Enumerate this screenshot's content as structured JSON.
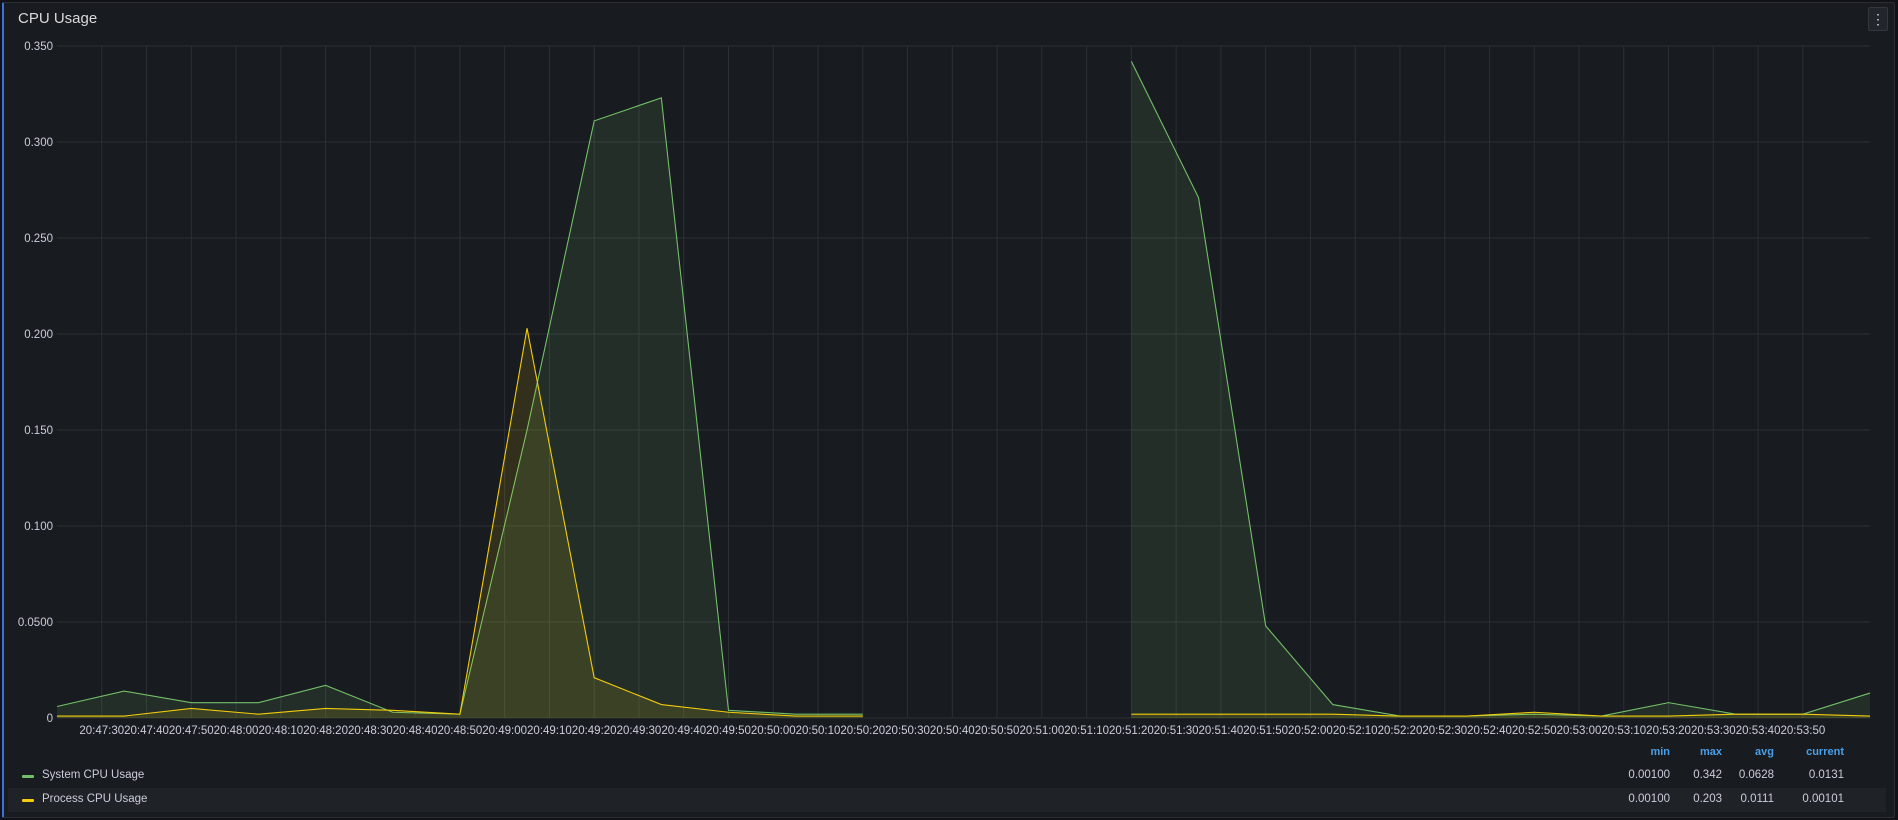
{
  "panel": {
    "title": "CPU Usage",
    "menu_icon": "vertical-dots-icon"
  },
  "legend": {
    "headers": {
      "min": "min",
      "max": "max",
      "avg": "avg",
      "current": "current"
    },
    "rows": [
      {
        "name": "System CPU Usage",
        "color": "#73bf69",
        "min": "0.00100",
        "max": "0.342",
        "avg": "0.0628",
        "current": "0.0131"
      },
      {
        "name": "Process CPU Usage",
        "color": "#f2cc0c",
        "min": "0.00100",
        "max": "0.203",
        "avg": "0.0111",
        "current": "0.00101"
      }
    ]
  },
  "chart_data": {
    "type": "area",
    "title": "CPU Usage",
    "xlabel": "",
    "ylabel": "",
    "ylim": [
      0,
      0.35
    ],
    "y_ticks": [
      "0",
      "0.0500",
      "0.100",
      "0.150",
      "0.200",
      "0.250",
      "0.300",
      "0.350"
    ],
    "x_tick_labels": [
      "20:47:30",
      "20:47:40",
      "20:47:50",
      "20:48:00",
      "20:48:10",
      "20:48:20",
      "20:48:30",
      "20:48:40",
      "20:48:50",
      "20:49:00",
      "20:49:10",
      "20:49:20",
      "20:49:30",
      "20:49:40",
      "20:49:50",
      "20:50:00",
      "20:50:10",
      "20:50:20",
      "20:50:30",
      "20:50:40",
      "20:50:50",
      "20:51:00",
      "20:51:10",
      "20:51:20",
      "20:51:30",
      "20:51:40",
      "20:51:50",
      "20:52:00",
      "20:52:10",
      "20:52:20",
      "20:52:30",
      "20:52:40",
      "20:52:50",
      "20:53:00",
      "20:53:10",
      "20:53:20",
      "20:53:30",
      "20:53:40",
      "20:53:50"
    ],
    "grid": true,
    "legend_position": "bottom",
    "series": [
      {
        "name": "System CPU Usage",
        "color": "#73bf69",
        "points": [
          [
            "20:47:20",
            0.006
          ],
          [
            "20:47:35",
            0.014
          ],
          [
            "20:47:50",
            0.008
          ],
          [
            "20:48:05",
            0.008
          ],
          [
            "20:48:20",
            0.017
          ],
          [
            "20:48:35",
            0.003
          ],
          [
            "20:48:50",
            0.002
          ],
          [
            "20:49:05",
            0.15
          ],
          [
            "20:49:20",
            0.311
          ],
          [
            "20:49:35",
            0.323
          ],
          [
            "20:49:50",
            0.004
          ],
          [
            "20:50:05",
            0.002
          ],
          [
            "20:50:20",
            0.002
          ],
          null,
          [
            "20:51:20",
            0.342
          ],
          [
            "20:51:35",
            0.271
          ],
          [
            "20:51:50",
            0.048
          ],
          [
            "20:52:05",
            0.007
          ],
          [
            "20:52:20",
            0.001
          ],
          [
            "20:52:35",
            0.001
          ],
          [
            "20:52:50",
            0.002
          ],
          [
            "20:53:05",
            0.001
          ],
          [
            "20:53:20",
            0.008
          ],
          [
            "20:53:35",
            0.002
          ],
          [
            "20:53:50",
            0.002
          ],
          [
            "20:54:05",
            0.013
          ]
        ]
      },
      {
        "name": "Process CPU Usage",
        "color": "#f2cc0c",
        "points": [
          [
            "20:47:20",
            0.001
          ],
          [
            "20:47:35",
            0.001
          ],
          [
            "20:47:50",
            0.005
          ],
          [
            "20:48:05",
            0.002
          ],
          [
            "20:48:20",
            0.005
          ],
          [
            "20:48:35",
            0.004
          ],
          [
            "20:48:50",
            0.002
          ],
          [
            "20:49:05",
            0.203
          ],
          [
            "20:49:20",
            0.021
          ],
          [
            "20:49:35",
            0.007
          ],
          [
            "20:49:50",
            0.003
          ],
          [
            "20:50:05",
            0.001
          ],
          [
            "20:50:20",
            0.001
          ],
          null,
          [
            "20:51:20",
            0.002
          ],
          [
            "20:51:35",
            0.002
          ],
          [
            "20:51:50",
            0.002
          ],
          [
            "20:52:05",
            0.002
          ],
          [
            "20:52:20",
            0.001
          ],
          [
            "20:52:35",
            0.001
          ],
          [
            "20:52:50",
            0.003
          ],
          [
            "20:53:05",
            0.001
          ],
          [
            "20:53:20",
            0.001
          ],
          [
            "20:53:35",
            0.002
          ],
          [
            "20:53:50",
            0.002
          ],
          [
            "20:54:05",
            0.001
          ]
        ]
      }
    ]
  }
}
